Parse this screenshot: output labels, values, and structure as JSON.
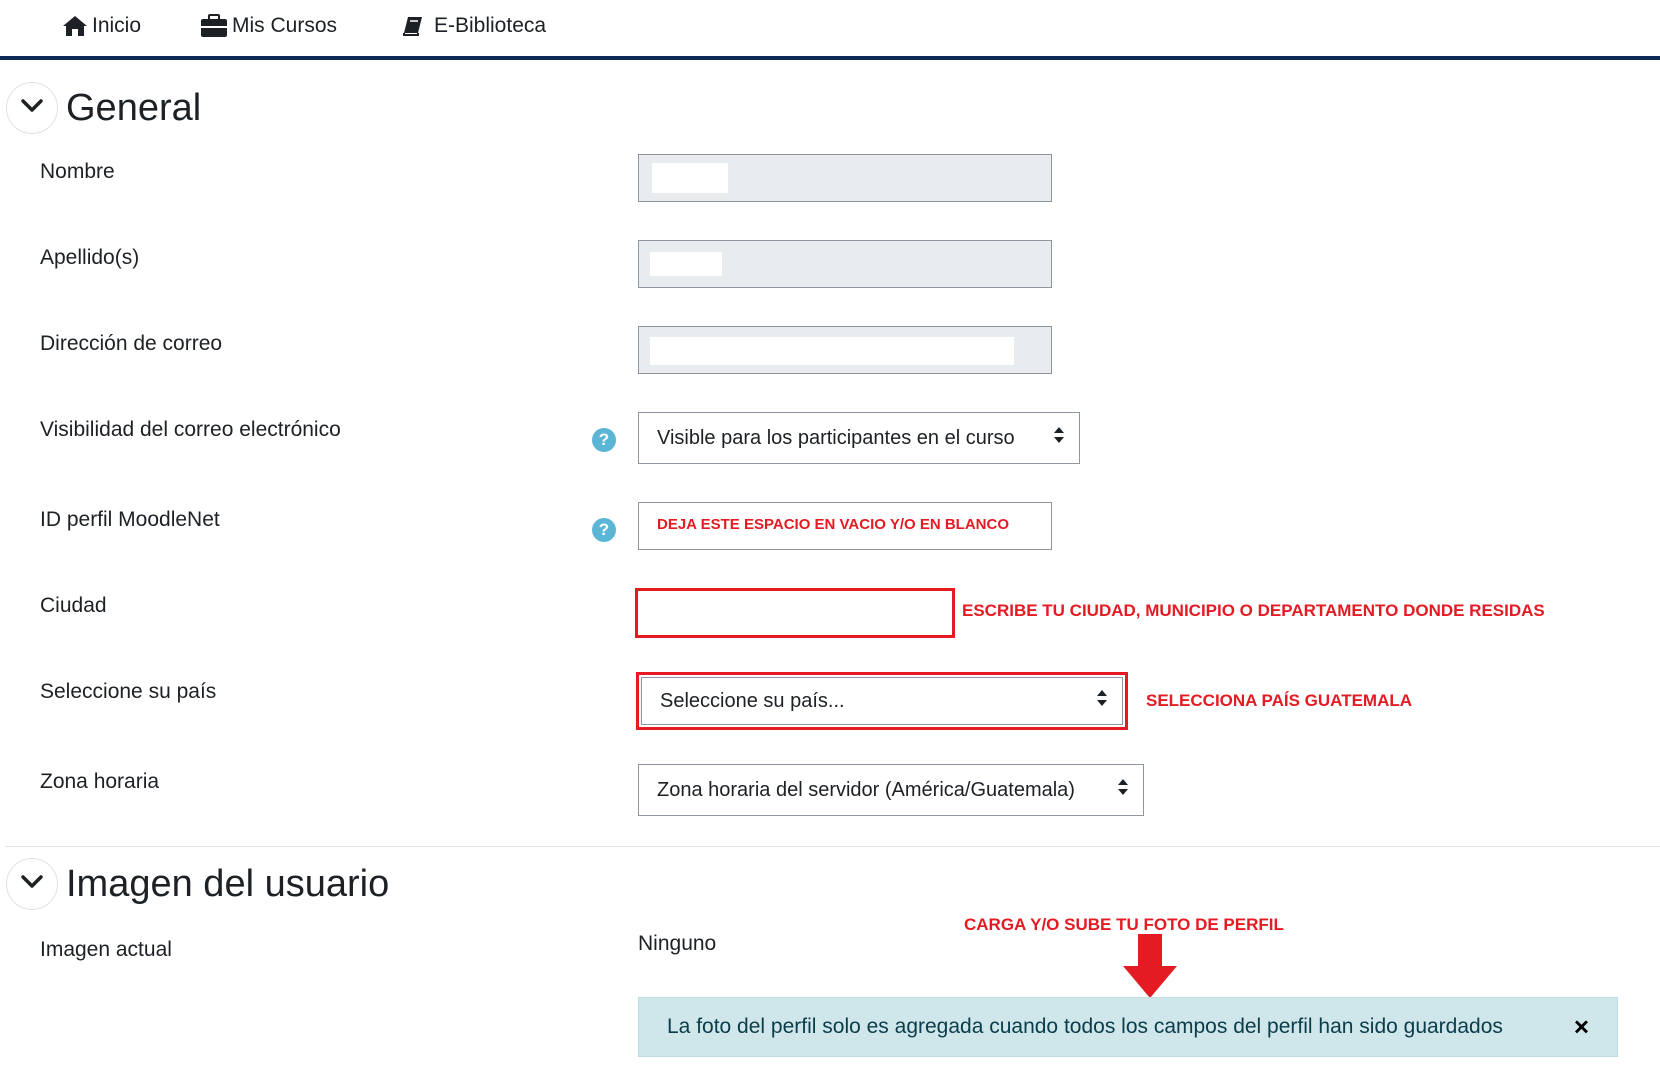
{
  "nav": {
    "inicio": "Inicio",
    "mis_cursos": "Mis Cursos",
    "biblioteca": "E-Biblioteca"
  },
  "general": {
    "title": "General",
    "nombre_label": "Nombre",
    "apellidos_label": "Apellido(s)",
    "correo_label": "Dirección de correo",
    "visibilidad_label": "Visibilidad del correo electrónico",
    "visibilidad_value": "Visible para los participantes en el curso",
    "moodlenet_label": "ID perfil MoodleNet",
    "moodlenet_note": "DEJA ESTE ESPACIO EN VACIO Y/O EN BLANCO",
    "ciudad_label": "Ciudad",
    "ciudad_note": "ESCRIBE TU CIUDAD, MUNICIPIO O DEPARTAMENTO DONDE RESIDAS",
    "pais_label": "Seleccione su país",
    "pais_value": "Seleccione su país...",
    "pais_note": "SELECCIONA PAÍS GUATEMALA",
    "zona_label": "Zona horaria",
    "zona_value": "Zona horaria del servidor (América/Guatemala)"
  },
  "imagen": {
    "title": "Imagen del usuario",
    "actual_label": "Imagen actual",
    "actual_value": "Ninguno",
    "upload_note": "CARGA Y/O SUBE TU FOTO DE PERFIL",
    "alert_text": "La foto del perfil solo es agregada cuando todos los campos del perfil han sido guardados",
    "alert_close": "×"
  },
  "colors": {
    "nav_border": "#0f2a57",
    "annotation_red": "#e41b23",
    "help_icon": "#5bb6d6",
    "alert_bg": "#cfe6ea"
  }
}
